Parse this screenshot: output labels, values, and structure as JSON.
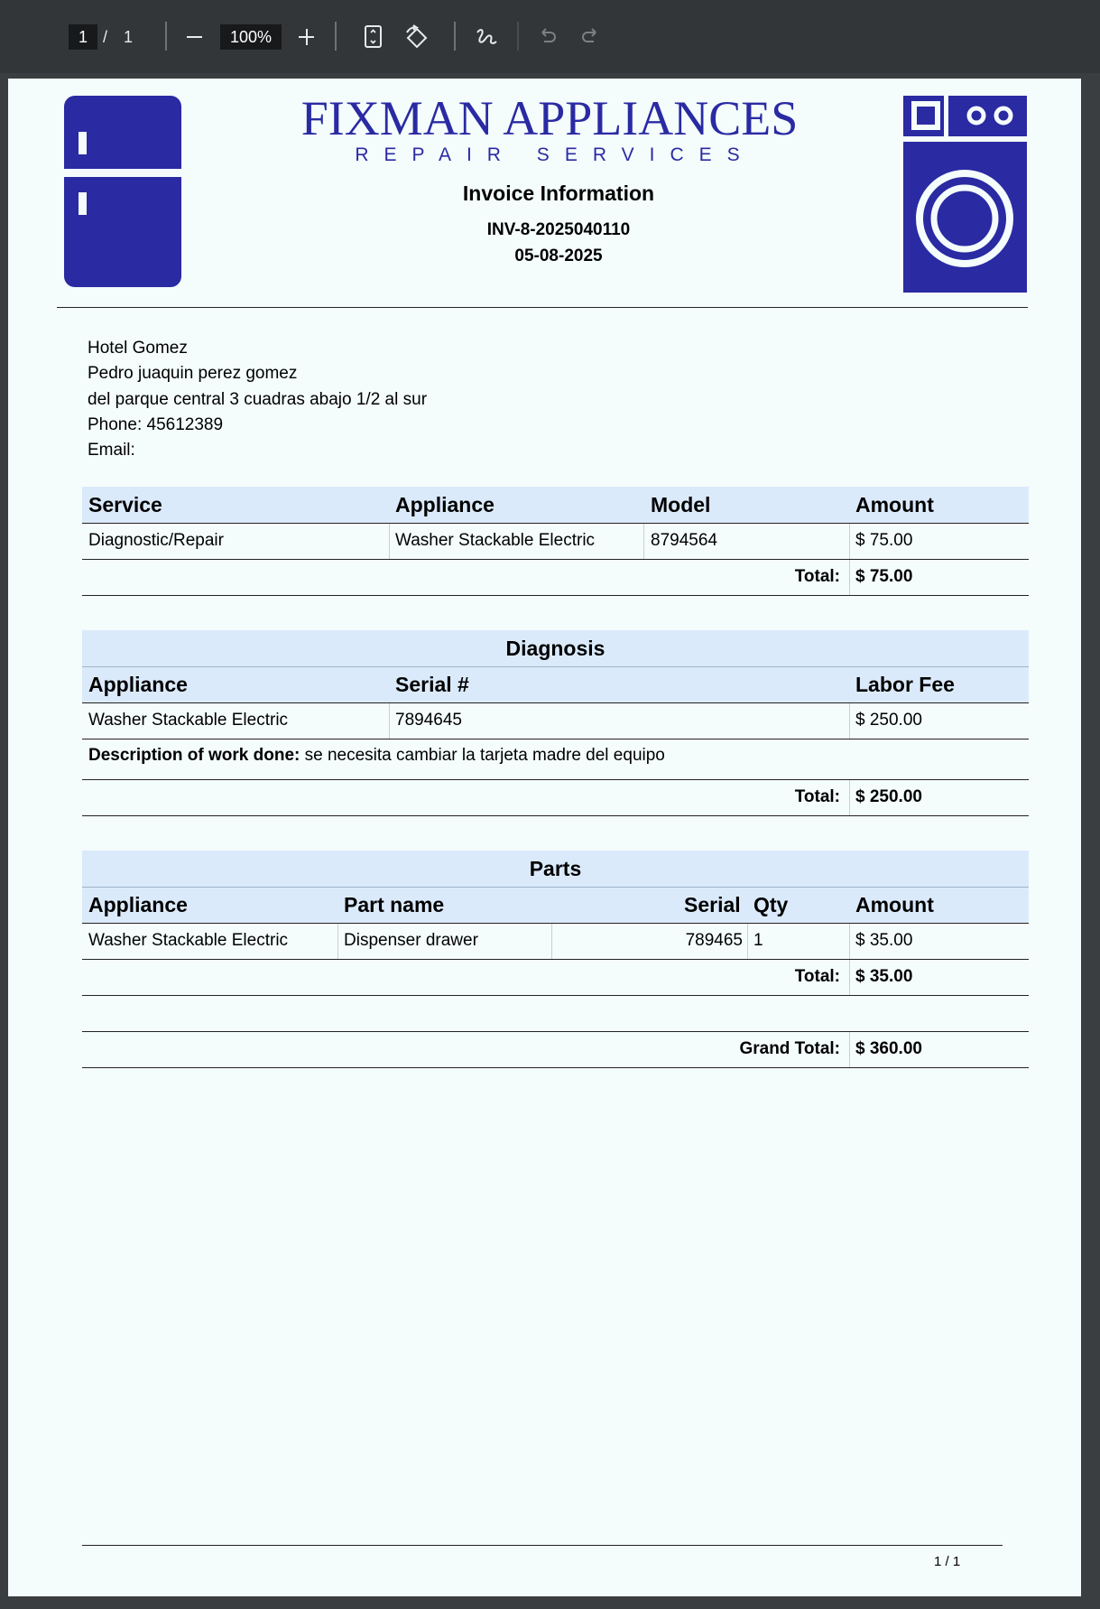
{
  "viewer": {
    "current_page": "1",
    "page_separator": "/",
    "total_pages": "1",
    "zoom": "100%"
  },
  "company": {
    "name": "FIXMAN APPLIANCES",
    "tagline": "REPAIR SERVICES",
    "brand_color": "#2a2aa3"
  },
  "invoice": {
    "title": "Invoice Information",
    "number": "INV-8-2025040110",
    "date": "05-08-2025"
  },
  "customer": {
    "name": "Hotel Gomez",
    "contact": "Pedro juaquin perez gomez",
    "address": "del parque central 3 cuadras abajo 1/2 al sur",
    "phone": "Phone: 45612389",
    "email": "Email:"
  },
  "services": {
    "headers": [
      "Service",
      "Appliance",
      "Model",
      "Amount"
    ],
    "rows": [
      [
        "Diagnostic/Repair",
        "Washer Stackable Electric",
        "8794564",
        "$ 75.00"
      ]
    ],
    "total_label": "Total:",
    "total_value": "$ 75.00"
  },
  "diagnosis": {
    "title": "Diagnosis",
    "headers": [
      "Appliance",
      "Serial #",
      "Labor Fee"
    ],
    "rows": [
      [
        "Washer Stackable Electric",
        "7894645",
        "$ 250.00"
      ]
    ],
    "description_label": "Description of work done:",
    "description_text": " se necesita cambiar la tarjeta madre del equipo",
    "total_label": "Total:",
    "total_value": "$ 250.00"
  },
  "parts": {
    "title": "Parts",
    "headers": [
      "Appliance",
      "Part name",
      "Serial",
      "Qty",
      "Amount"
    ],
    "rows": [
      [
        "Washer Stackable Electric",
        "Dispenser drawer",
        "789465",
        "1",
        "$ 35.00"
      ]
    ],
    "total_label": "Total:",
    "total_value": "$ 35.00"
  },
  "grand_total": {
    "label": "Grand Total:",
    "value": "$ 360.00"
  },
  "footer": {
    "page_indicator": "1 / 1"
  }
}
